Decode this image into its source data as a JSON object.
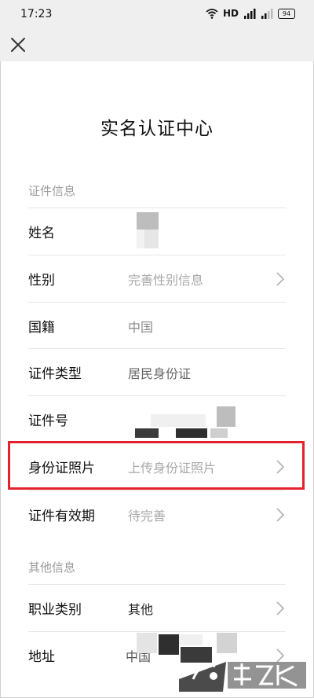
{
  "status_bar": {
    "time": "17:23",
    "network": "HD",
    "battery": "94"
  },
  "nav": {
    "close_icon": "close-icon"
  },
  "page": {
    "title": "实名认证中心"
  },
  "sections": {
    "certificate_info": "证件信息",
    "other_info": "其他信息"
  },
  "rows": {
    "name": {
      "label": "姓名",
      "value": ""
    },
    "gender": {
      "label": "性别",
      "value": "完善性别信息"
    },
    "nationality": {
      "label": "国籍",
      "value": "中国"
    },
    "id_type": {
      "label": "证件类型",
      "value": "居民身份证"
    },
    "id_number": {
      "label": "证件号",
      "value": ""
    },
    "id_photo": {
      "label": "身份证照片",
      "value": "上传身份证照片"
    },
    "id_validity": {
      "label": "证件有效期",
      "value": "待完善"
    },
    "occupation": {
      "label": "职业类别",
      "value": "其他"
    },
    "address": {
      "label": "地址",
      "value": "中国"
    }
  },
  "colors": {
    "highlight": "#e3222c",
    "hint": "#a8a8a8",
    "bar": "#efefef"
  }
}
